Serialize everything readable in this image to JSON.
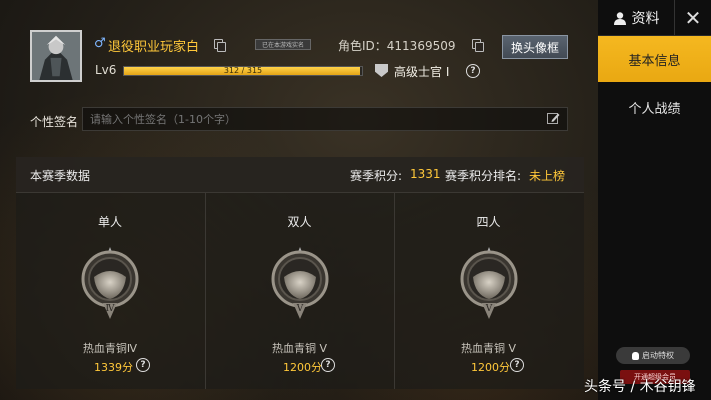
{
  "header": {
    "player_name": "退役职业玩家白",
    "in_game_badge": "已在本游戏实名",
    "role_id": "角色ID：411369509",
    "change_frame_label": "换头像框",
    "level": "Lv6",
    "xp_text": "312 / 315",
    "xp_progress": 0.99,
    "rank_name": "高级士官 Ⅰ"
  },
  "signature": {
    "label": "个性签名",
    "placeholder": "请输入个性签名（1-10个字）"
  },
  "season": {
    "title": "本赛季数据",
    "points_label": "赛季积分:",
    "points_value": "1331",
    "rank_label": "赛季积分排名:",
    "rank_value": "未上榜",
    "modes": [
      {
        "title": "单人",
        "tier": "热血青铜Ⅳ",
        "tier_numeral": "Ⅳ",
        "points": "1339分"
      },
      {
        "title": "双人",
        "tier": "热血青铜 Ⅴ",
        "tier_numeral": "Ⅴ",
        "points": "1200分"
      },
      {
        "title": "四人",
        "tier": "热血青铜 Ⅴ",
        "tier_numeral": "Ⅴ",
        "points": "1200分"
      }
    ]
  },
  "side": {
    "title": "资料",
    "tabs": [
      "基本信息",
      "个人战绩"
    ],
    "privilege_button": "启动特权",
    "vip_button": "开通超级会员"
  },
  "watermark": "头条号 / 木谷钥锋",
  "colors": {
    "accent": "#ffc83a",
    "active_tab": "#f5b820"
  }
}
